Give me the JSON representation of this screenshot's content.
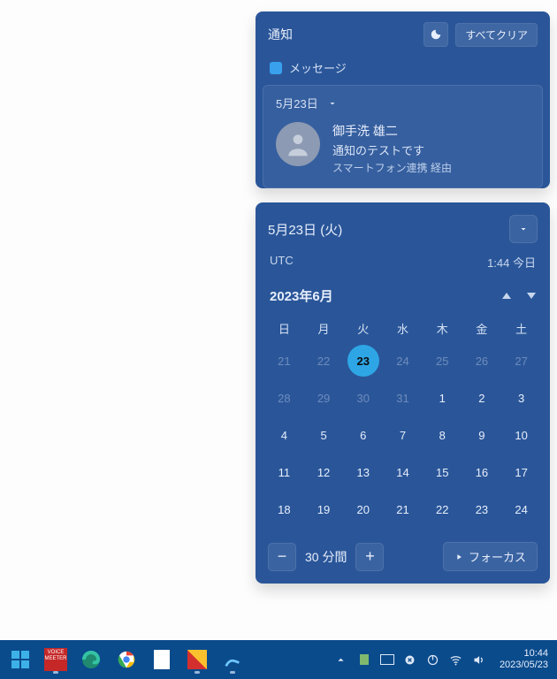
{
  "notif": {
    "title": "通知",
    "clear_all": "すべてクリア",
    "app_label": "メッセージ",
    "item": {
      "date": "5月23日",
      "sender": "御手洗 雄二",
      "body": "通知のテストです",
      "via": "スマートフォン連携 経由"
    }
  },
  "calendar": {
    "header_date": "5月23日 (火)",
    "tz_label": "UTC",
    "tz_time": "1:44 今日",
    "month_label": "2023年6月",
    "dow": [
      "日",
      "月",
      "火",
      "水",
      "木",
      "金",
      "土"
    ],
    "days": [
      {
        "n": "21",
        "dim": true
      },
      {
        "n": "22",
        "dim": true
      },
      {
        "n": "23",
        "dim": true,
        "today": true
      },
      {
        "n": "24",
        "dim": true
      },
      {
        "n": "25",
        "dim": true
      },
      {
        "n": "26",
        "dim": true
      },
      {
        "n": "27",
        "dim": true
      },
      {
        "n": "28",
        "dim": true
      },
      {
        "n": "29",
        "dim": true
      },
      {
        "n": "30",
        "dim": true
      },
      {
        "n": "31",
        "dim": true
      },
      {
        "n": "1"
      },
      {
        "n": "2"
      },
      {
        "n": "3"
      },
      {
        "n": "4"
      },
      {
        "n": "5"
      },
      {
        "n": "6"
      },
      {
        "n": "7"
      },
      {
        "n": "8"
      },
      {
        "n": "9"
      },
      {
        "n": "10"
      },
      {
        "n": "11"
      },
      {
        "n": "12"
      },
      {
        "n": "13"
      },
      {
        "n": "14"
      },
      {
        "n": "15"
      },
      {
        "n": "16"
      },
      {
        "n": "17"
      },
      {
        "n": "18"
      },
      {
        "n": "19"
      },
      {
        "n": "20"
      },
      {
        "n": "21"
      },
      {
        "n": "22"
      },
      {
        "n": "23"
      },
      {
        "n": "24"
      }
    ],
    "focus": {
      "value": "30",
      "unit": "分間",
      "button": "フォーカス"
    }
  },
  "taskbar": {
    "clock_time": "10:44",
    "clock_date": "2023/05/23"
  }
}
